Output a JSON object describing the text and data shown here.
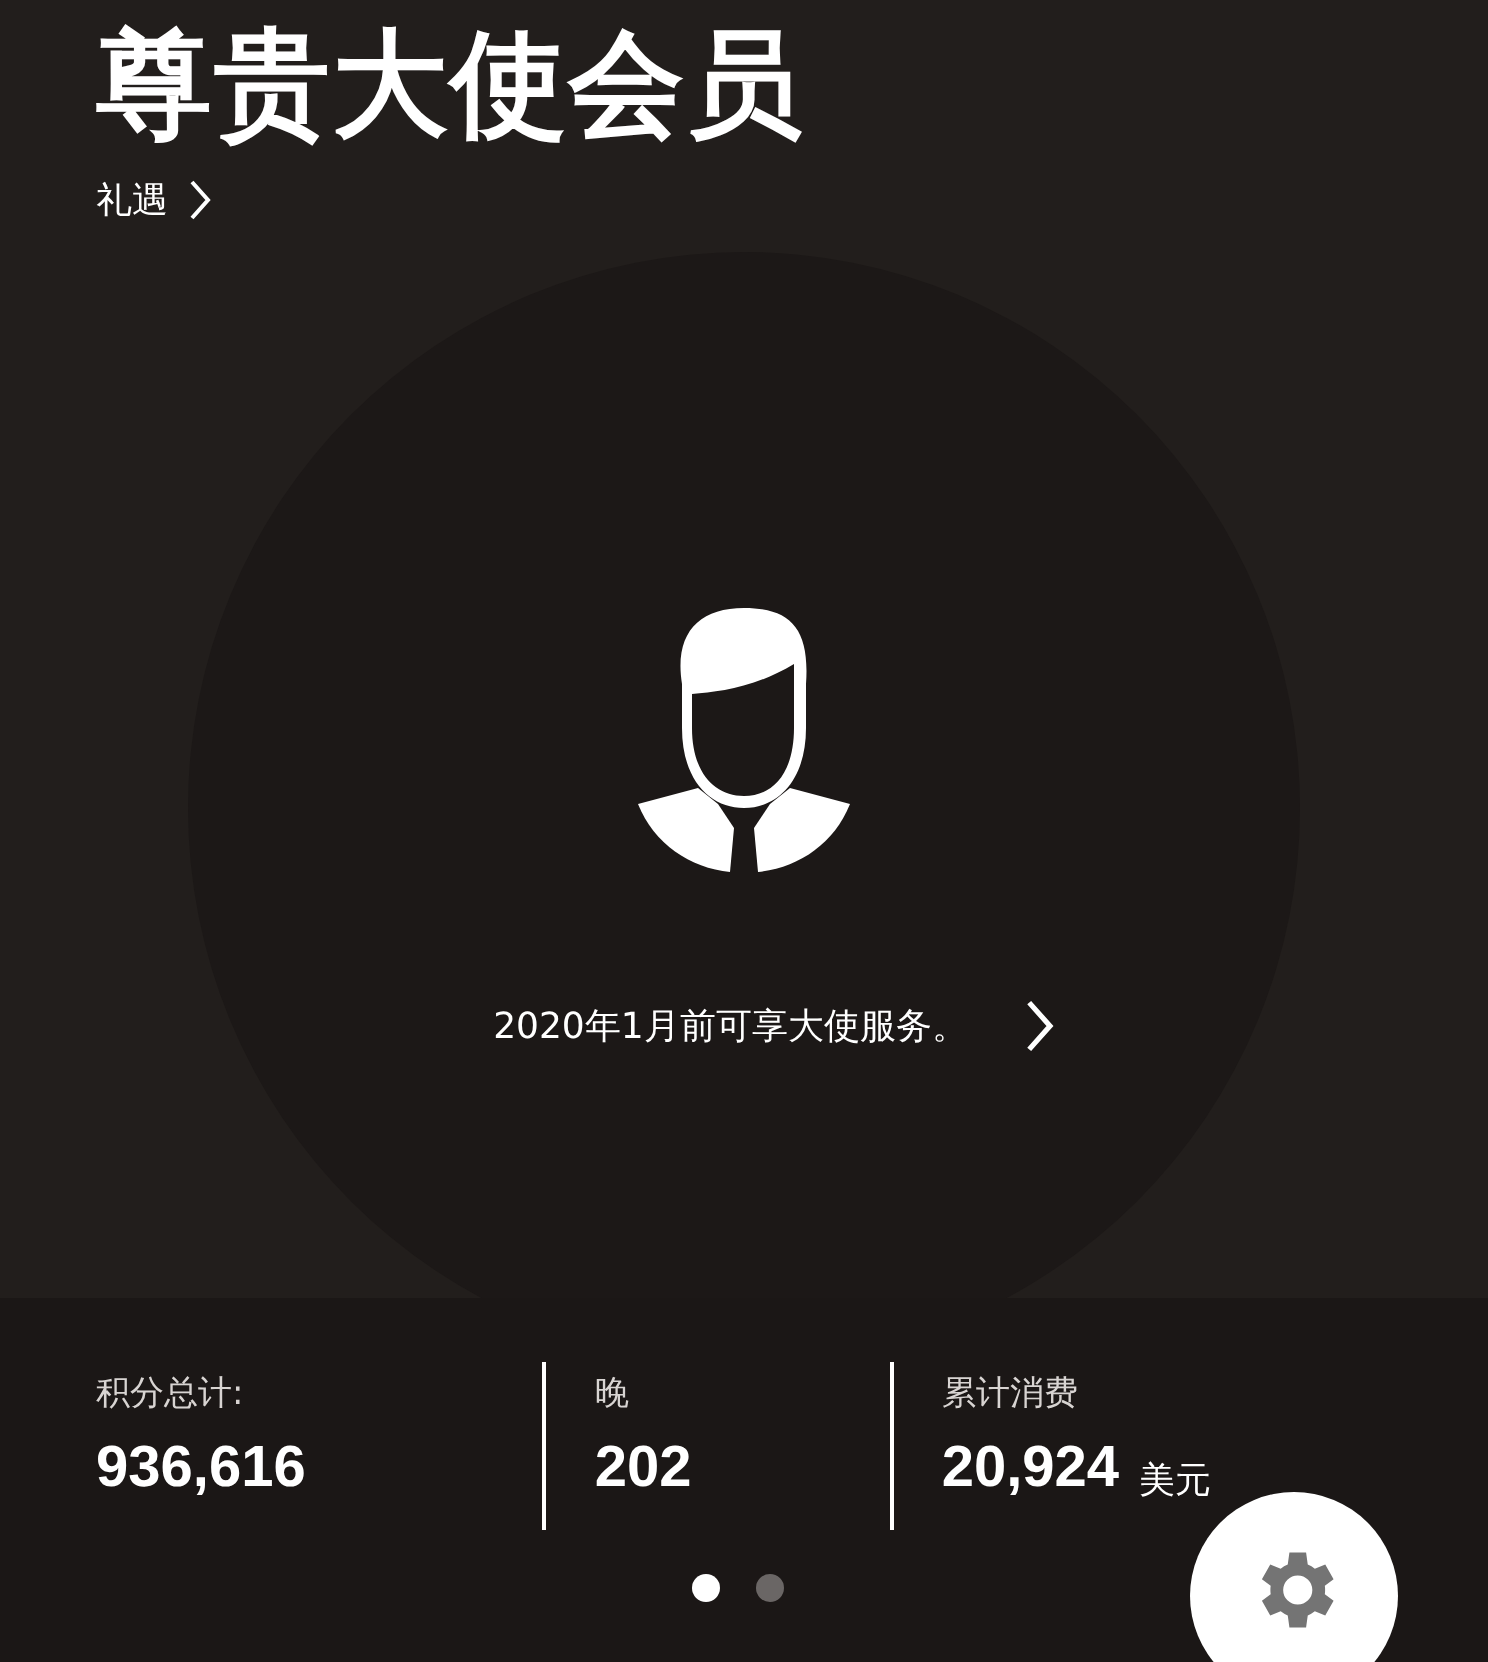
{
  "header": {
    "title": "尊贵大使会员",
    "link": "礼遇"
  },
  "hero": {
    "message": "2020年1月前可享大使服务。"
  },
  "stats": [
    {
      "label": "积分总计:",
      "value": "936,616"
    },
    {
      "label": "晚",
      "value": "202"
    },
    {
      "label": "累计消费",
      "value": "20,924",
      "unit": "美元"
    }
  ],
  "pager": [
    {
      "selected": true
    },
    {
      "selected": false
    }
  ]
}
